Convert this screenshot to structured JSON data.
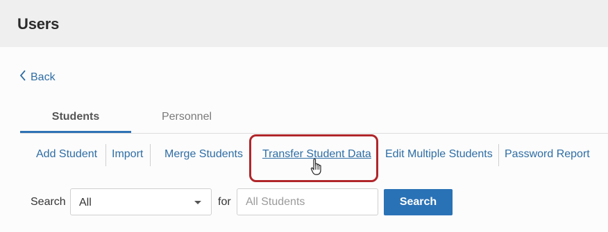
{
  "header": {
    "title": "Users"
  },
  "back": {
    "label": "Back"
  },
  "tabs": [
    {
      "label": "Students",
      "active": true
    },
    {
      "label": "Personnel",
      "active": false
    }
  ],
  "actions": [
    {
      "label": "Add Student"
    },
    {
      "label": "Import"
    },
    {
      "label": "Merge Students"
    },
    {
      "label": "Transfer Student Data",
      "highlighted": true
    },
    {
      "label": "Edit Multiple Students"
    },
    {
      "label": "Password Report"
    }
  ],
  "search": {
    "label": "Search",
    "scope_value": "All",
    "for_label": "for",
    "placeholder": "All Students",
    "value": "",
    "button_label": "Search"
  },
  "colors": {
    "link": "#2e6da4",
    "tab_underline": "#2e72b5",
    "highlight_border": "#b0262b",
    "button": "#2a72b6",
    "header_bg": "#efefef"
  },
  "icons": {
    "back": "chevron-left-icon",
    "cursor": "hand-pointer-icon",
    "dropdown": "chevron-down-icon"
  }
}
